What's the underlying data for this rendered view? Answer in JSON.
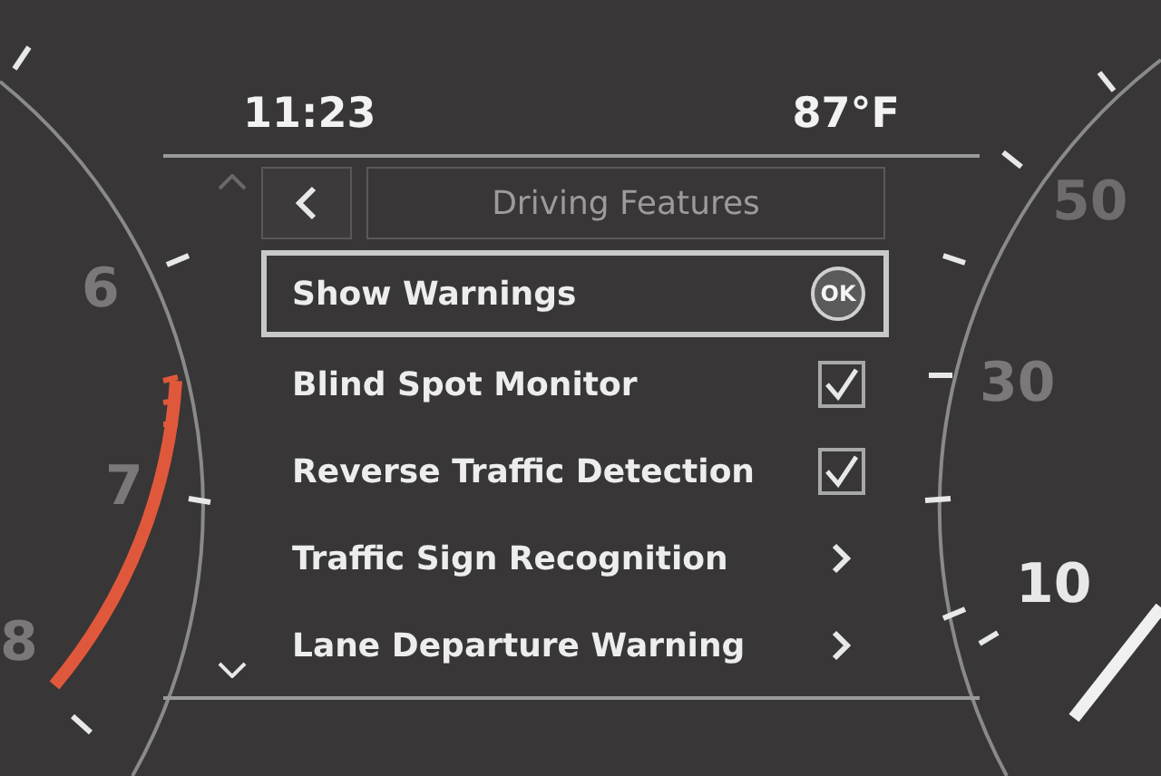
{
  "status": {
    "time": "11:23",
    "temperature": "87°F"
  },
  "left_gauge": {
    "labels": [
      "6",
      "7",
      "8"
    ]
  },
  "right_gauge": {
    "labels": [
      "50",
      "30",
      "10"
    ]
  },
  "menu": {
    "title": "Driving Features",
    "items": [
      {
        "kind": "action",
        "label": "Show Warnings",
        "selected": true,
        "badge": "OK"
      },
      {
        "kind": "checkbox",
        "label": "Blind Spot Monitor",
        "selected": false,
        "checked": true
      },
      {
        "kind": "checkbox",
        "label": "Reverse Traffic Detection",
        "selected": false,
        "checked": true
      },
      {
        "kind": "submenu",
        "label": "Traffic Sign Recognition",
        "selected": false
      },
      {
        "kind": "submenu",
        "label": "Lane Departure Warning",
        "selected": false
      }
    ]
  }
}
